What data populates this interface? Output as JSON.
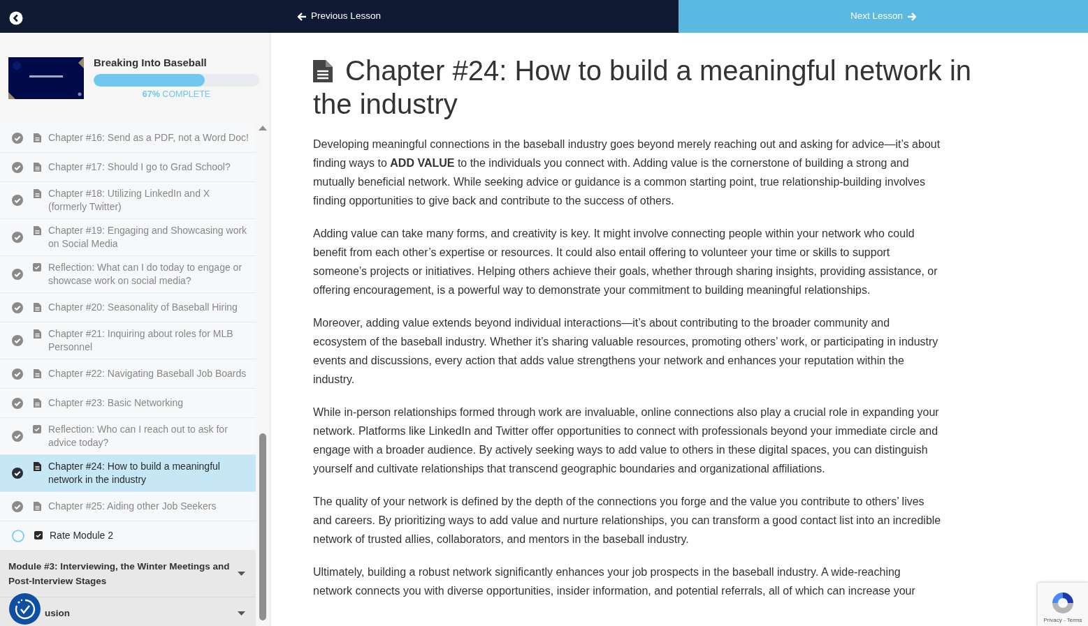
{
  "top_bar": {
    "previous_label": "Previous Lesson",
    "next_label": "Next Lesson"
  },
  "course": {
    "title": "Breaking Into Baseball",
    "level": 0.67,
    "progress_text": "**67%** COMPLETE"
  },
  "lessons": [
    {
      "kind": "chapter",
      "title": "Chapter #16: Send as a PDF, not a Word Doc!",
      "completed": true,
      "selected": false
    },
    {
      "kind": "chapter",
      "title": "Chapter #17: Should I go to Grad School?",
      "completed": true,
      "selected": false
    },
    {
      "kind": "chapter",
      "title": "Chapter #18: Utilizing LinkedIn and X (formerly Twitter)",
      "completed": true,
      "selected": false
    },
    {
      "kind": "chapter",
      "title": "Chapter #19: Engaging and Showcasing work on Social Media",
      "completed": true,
      "selected": false
    },
    {
      "kind": "reflection",
      "title": "Reflection: What can I do today to engage or showcase work on social media?",
      "completed": true,
      "selected": false
    },
    {
      "kind": "chapter",
      "title": "Chapter #20: Seasonality of Baseball Hiring",
      "completed": true,
      "selected": false
    },
    {
      "kind": "chapter",
      "title": "Chapter #21: Inquiring about roles for MLB Personnel",
      "completed": true,
      "selected": false
    },
    {
      "kind": "chapter",
      "title": "Chapter #22: Navigating Baseball Job Boards",
      "completed": true,
      "selected": false
    },
    {
      "kind": "chapter",
      "title": "Chapter #23: Basic Networking",
      "completed": true,
      "selected": false
    },
    {
      "kind": "reflection",
      "title": "Reflection: Who can I reach out to ask for advice today?",
      "completed": true,
      "selected": false
    },
    {
      "kind": "chapter",
      "title": "Chapter #24: How to build a meaningful network in the industry",
      "completed": true,
      "selected": true
    },
    {
      "kind": "chapter",
      "title": "Chapter #25: Aiding other Job Seekers",
      "completed": true,
      "selected": false
    },
    {
      "kind": "reflection",
      "title": "Rate Module 2",
      "completed": false,
      "selected": false
    }
  ],
  "modules": [
    {
      "title": "Module #3: Interviewing, the Winter Meetings and Post-Interview Stages",
      "expanded": false
    },
    {
      "title": "usion",
      "expanded": false
    }
  ],
  "lesson": {
    "title": "Chapter #24: How to build a meaningful network in the industry",
    "paragraphs": [
      "Developing meaningful connections in the baseball industry goes beyond merely reaching out and asking for advice—it’s about finding ways to **ADD VALUE** to the individuals you connect with. Adding value is the cornerstone of building a strong and mutually beneficial network. While seeking advice or guidance is a common starting point, true relationship-building involves finding opportunities to give back and contribute to the success of others.",
      "Adding value can take many forms, and creativity is key. It might involve connecting people within your network who could benefit from each other’s expertise or resources. It could also entail offering to volunteer your time or skills to support someone’s projects or initiatives. Helping others achieve their goals, whether through sharing insights, providing assistance, or offering encouragement, is a powerful way to demonstrate your commitment to building meaningful relationships.",
      "Moreover, adding value extends beyond individual interactions—it’s about contributing to the broader community and ecosystem of the baseball industry. Whether it’s sharing valuable resources, promoting others’ work, or participating in industry events and discussions, every action that adds value strengthens your network and enhances your reputation within the industry.",
      "While in-person relationships formed through work are invaluable, online connections also play a crucial role in expanding your network. Platforms like LinkedIn and Twitter offer opportunities to connect with professionals beyond your immediate circle and engage with a broader audience. By actively seeking ways to add value to others in these digital spaces, you can distinguish yourself and cultivate relationships that transcend geographic boundaries and organizational affiliations.",
      "The quality of your network is defined by the depth of the connections you forge and the value you contribute to others’ lives and careers. By prioritizing ways to add value and nurture relationships, you can transform a good contact list into an incredible network of trusted allies, collaborators, and mentors in the baseball industry.",
      "Ultimately, building a robust network significantly enhances your job prospects in the baseball industry. A wide-reaching network connects you with diverse opportunities, insider information, and potential referrals, all of which can increase your"
    ]
  },
  "recaptcha": {
    "links": "Privacy - Terms"
  }
}
